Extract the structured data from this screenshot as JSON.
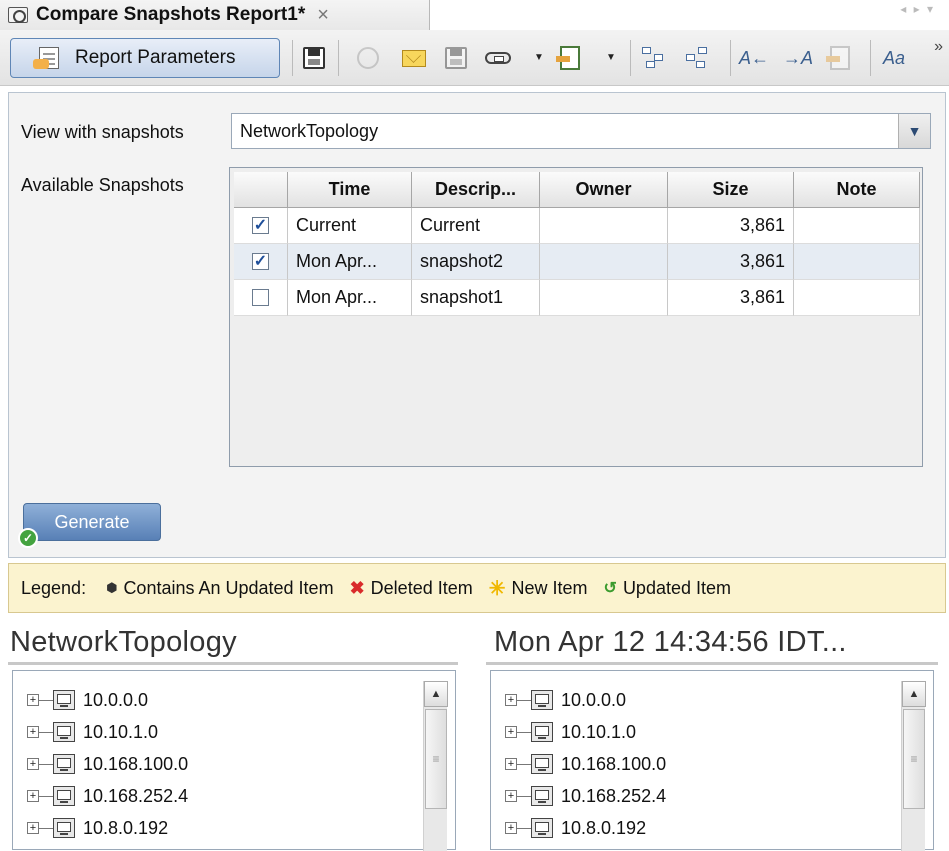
{
  "tab": {
    "title": "Compare Snapshots Report1*",
    "close": "×"
  },
  "toolbar": {
    "report_parameters_label": "Report Parameters",
    "icons": [
      "save-icon",
      "schedule-icon",
      "email-icon",
      "save-as-icon",
      "link-icon",
      "export-icon",
      "expand-tree-icon",
      "collapse-tree-icon",
      "previous-change-icon",
      "next-change-icon",
      "document-icon",
      "find-icon"
    ],
    "more": "»"
  },
  "params": {
    "view_label": "View with snapshots",
    "view_value": "NetworkTopology",
    "available_label": "Available Snapshots",
    "columns": [
      "",
      "Time",
      "Descrip...",
      "Owner",
      "Size",
      "Note"
    ],
    "rows": [
      {
        "checked": true,
        "time": "Current",
        "description": "Current",
        "owner": "",
        "size": "3,861",
        "note": ""
      },
      {
        "checked": true,
        "time": "Mon Apr...",
        "description": "snapshot2",
        "owner": "",
        "size": "3,861",
        "note": ""
      },
      {
        "checked": false,
        "time": "Mon Apr...",
        "description": "snapshot1",
        "owner": "",
        "size": "3,861",
        "note": ""
      }
    ],
    "generate_label": "Generate"
  },
  "legend": {
    "label": "Legend:",
    "contains_updated": "Contains An Updated Item",
    "deleted": "Deleted Item",
    "new": "New Item",
    "updated": "Updated Item"
  },
  "left_tree": {
    "title": "NetworkTopology",
    "nodes": [
      "10.0.0.0",
      "10.10.1.0",
      "10.168.100.0",
      "10.168.252.4",
      "10.8.0.192"
    ]
  },
  "right_tree": {
    "title": "Mon Apr 12 14:34:56 IDT...",
    "nodes": [
      "10.0.0.0",
      "10.10.1.0",
      "10.168.100.0",
      "10.168.252.4",
      "10.8.0.192"
    ]
  },
  "colors": {
    "accent": "#5880b6",
    "legend_bg": "#fbf3cf",
    "check": "#1f4f9a"
  }
}
